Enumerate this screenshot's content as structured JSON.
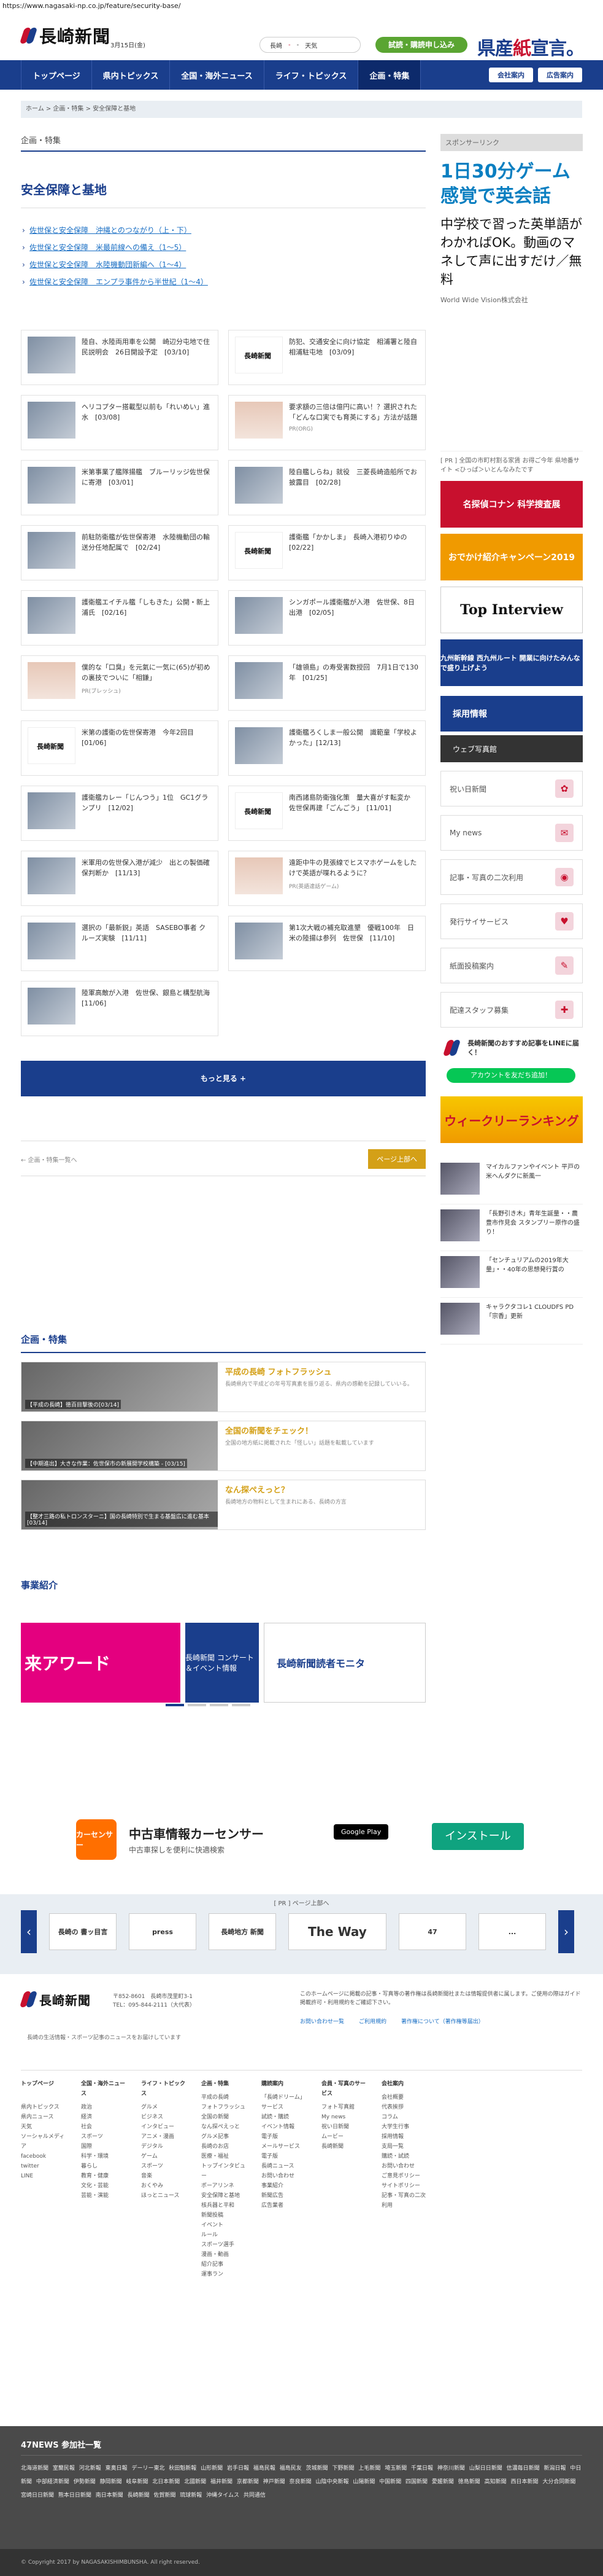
{
  "browser": {
    "url": "https://www.nagasaki-np.co.jp/feature/security-base/"
  },
  "header": {
    "logo": "長崎新聞",
    "date": "3月15日(金)",
    "weather": {
      "place": "長崎",
      "high": "-",
      "low": "-",
      "label": "天気"
    },
    "subscribe": "試読・購読申し込み",
    "campaign": {
      "a": "県産",
      "b": "紙",
      "c": "宣言"
    }
  },
  "nav": {
    "items": [
      "トップページ",
      "県内トピックス",
      "全国・海外ニュース",
      "ライフ・トピックス",
      "企画・特集"
    ],
    "member": "会社案内",
    "ad": "広告案内"
  },
  "breadcrumb": "ホーム > 企画・特集 > 安全保障と基地",
  "section_label": "企画・特集",
  "page_title": "安全保障と基地",
  "series": [
    "佐世保と安全保障　沖縄とのつながり（上・下）",
    "佐世保と安全保障　米最前線への備え（1～5）",
    "佐世保と安全保障　水陸機動団新編へ（1～4）",
    "佐世保と安全保障　エンプラ事件から半世紀（1～4）"
  ],
  "articles": [
    {
      "title": "陸自、水陸両用車を公開　崎辺分屯地で住民説明会　26日開設予定　[03/10]",
      "thumb": "photo",
      "src": ""
    },
    {
      "title": "防犯、交通安全に向け協定　相浦署と陸自相浦駐屯地　[03/09]",
      "thumb": "logo",
      "src": ""
    },
    {
      "title": "ヘリコプター搭載型以前も「れいめい」進水　[03/08]",
      "thumb": "photo",
      "src": ""
    },
    {
      "title": "要求額の三倍は億円に高い！？選択された「どんな口実でも育英にする」方法が話題",
      "thumb": "person",
      "src": "PR(ORG)"
    },
    {
      "title": "米第事業了艦隊揚艦　ブルーリッジ佐世保に寄港　[03/01]",
      "thumb": "photo",
      "src": ""
    },
    {
      "title": "陸自艦しらね」就役　三菱長崎造船所でお披露目　[02/28]",
      "thumb": "photo",
      "src": ""
    },
    {
      "title": "前駐防衛艦が佐世保寄港　水陸機動団の輸送分任地配属で　[02/24]",
      "thumb": "photo",
      "src": ""
    },
    {
      "title": "護衛艦「かかしま」　長崎入港初りゆの　[02/22]",
      "thumb": "logo",
      "src": ""
    },
    {
      "title": "護衛艦エイチル艦「しもきた」公開・新上浦氏　[02/16]",
      "thumb": "photo",
      "src": ""
    },
    {
      "title": "シンガポール護衛艦が入港　佐世保、8日出港　[02/05]",
      "thumb": "photo",
      "src": ""
    },
    {
      "title": "僕的な「口臭」を元氣に一気に(65)が初めの裏技でついに「相鎌」",
      "thumb": "person",
      "src": "PR(ブレッシュ)"
    },
    {
      "title": "「雄領島」の寿受害数授回　7月1日で130年　[01/25]",
      "thumb": "photo",
      "src": ""
    },
    {
      "title": "米第の護衛の佐世保寄港　今年2回目　[01/06]",
      "thumb": "logo",
      "src": ""
    },
    {
      "title": "護衛艦ろくしま一般公開　識範童「学校よかった」[12/13]",
      "thumb": "photo",
      "src": ""
    },
    {
      "title": "護衛艦カレー「じんつう」1位　GC1グランプリ　[12/02]",
      "thumb": "photo",
      "src": ""
    },
    {
      "title": "南西諸島防衛強化策　量大喜がす転変か　佐世保再建「ごんごう」　[11/01]",
      "thumb": "logo",
      "src": ""
    },
    {
      "title": "米軍用の佐世保入港が減少　出との製価確保判断か　[11/13]",
      "thumb": "photo",
      "src": ""
    },
    {
      "title": "遠距中牛の見張線でヒスマホゲームをしたけで英語が喋れるように？",
      "thumb": "person",
      "src": "PR(英語達話ゲーム)"
    },
    {
      "title": "選択の「最新鋭」英語　SASEBO事者 クルーズ実験　[11/11]",
      "thumb": "photo",
      "src": ""
    },
    {
      "title": "第1次大戦の補充取進墾　優戦100年　日米の陸揚は参列　佐世保　[11/10]",
      "thumb": "photo",
      "src": ""
    },
    {
      "title": "陸軍高敵が入港　佐世保、銀島と構型航海　[11/06]",
      "thumb": "photo",
      "src": ""
    }
  ],
  "more_button": "もっと見る +",
  "pager": {
    "back": "← 企画・特集一覧へ",
    "top": "ページ上部へ"
  },
  "sidebar": {
    "sponsor": "スポンサーリンク",
    "ad": {
      "headline": "1日30分ゲーム感覚で英会話",
      "body": "中学校で習った英単語がわかればOK。動画のマネして声に出すだけ／無料",
      "src": "World Wide Vision株式会社"
    },
    "ad_note": "[ PR ] 全国の市町村割る家賃 お得ご今年 県地番サイト <ひっぱ＞いとんなみたです",
    "banners": [
      "名探偵コナン 科学捜査展",
      "おでかけ紹介キャンペーン2019",
      "Top Interview",
      "九州新幹線 西九州ルート 開業に向けたみんなで盛り上げよう"
    ],
    "recruit": "採用情報",
    "recruit2": "ウェブ写真館",
    "services": [
      "祝い日新聞",
      "My news",
      "記事・写真の二次利用",
      "発行サイサービス",
      "紙面投稿案内",
      "配達スタッフ募集"
    ],
    "line": {
      "title": "長崎新聞のおすすめ記事をLINEに届く！",
      "button": "アカウントを友だち追加！"
    },
    "rank": "ウィークリーランキング",
    "side_news": [
      "マイカルファンやイベント 平戸の米へんダクに新風一",
      "「長野引き木」青年生誕量・・農豊市作見会 スタンプリー原作の盛り！",
      "「センチュリアムの2019年大量」・・40年の思想発行賞の",
      "キャラクタコレ1 CLOUDFS  PD「宗香」更新"
    ]
  },
  "features": {
    "title": "企画・特集",
    "items": [
      {
        "caption": "【平成の長崎】徳百目撃後の[03/14]",
        "title": "平成の長崎 フォトフラッシュ",
        "desc": "長崎県内で平成どの年号写真素を振り返る、県内の感動を記録していいる。"
      },
      {
        "caption": "【中期進出】大きな作業：佐世保市の新展開学校構築 - [03/15]",
        "title": "全国の新聞をチェック！",
        "desc": "全国の地方紙に掲載された「怪しい」話題を転載しています"
      },
      {
        "caption": "【整才三路の私トロンスターニ】国の長崎特別で生まる基盤広に進む基本 [03/14]",
        "title": "なん探ぺえっと？",
        "desc": "長崎地方の物料として生まれにある、長崎の方言"
      }
    ]
  },
  "business": {
    "title": "事業紹介",
    "slides": [
      "来アワード",
      "長崎新聞 コンサート＆イベント情報",
      "長崎新聞読者モニタ"
    ]
  },
  "bottom_ad": {
    "logo": "カーセンサー",
    "name": "中古車情報カーセンサー",
    "sub": "中古車探しを便利に快適検索",
    "store": "Google Play",
    "install": "インストール"
  },
  "partner_banners": {
    "label": "[ PR ] ページ上部へ",
    "items": [
      "長崎の 書ッ目言",
      "press",
      "長崎地方 新聞",
      "The Way",
      "47",
      "..."
    ]
  },
  "footer": {
    "logo": "長崎新聞",
    "address": "〒852-8601　長崎市茂里町3-1\nTEL：095-844-2111（大代表）",
    "note": "長崎の生活情報・スポーツ記事のニュースをお届けしています",
    "copyright": "このホームページに掲載の記事・写真等の著作権は長崎新聞社または情報提供者に属します。ご使用の際はガイド掲載許可・利用規約をご確認下さい。",
    "links": [
      "お問い合わせ一覧",
      "ご利用規約",
      "著作権について（著作権等届出）"
    ]
  },
  "sitemap": [
    {
      "head": "トップページ",
      "items": [
        "",
        "県内トピックス",
        "県内ニュース",
        "天気",
        "ソーシャルメディア",
        "facebook",
        "twitter",
        "LINE"
      ]
    },
    {
      "head": "全国・海外ニュース",
      "items": [
        "政治",
        "経済",
        "社会",
        "スポーツ",
        "国際",
        "科学・環境",
        "暮らし",
        "教育・健康",
        "文化・芸能",
        "芸能・演能"
      ]
    },
    {
      "head": "ライフ・トピックス",
      "items": [
        "グルメ",
        "ビジネス",
        "インタビュー",
        "アニメ・漫画",
        "デジタル",
        "ゲーム",
        "スポーツ",
        "音楽",
        "おくやみ",
        "ほっとニュース"
      ]
    },
    {
      "head": "企画・特集",
      "items": [
        "平成の長崎",
        "フォトフラッシュ",
        "全国の新聞",
        "なん探ぺえっと",
        "グルメ記事",
        "長崎のお店",
        "医療・福祉",
        "トップインタビュー",
        "ポーアリンネ",
        "安全保障と基地",
        "核兵器と平和",
        "新聞投稿",
        "イベント",
        "ルール",
        "スポーツ選手",
        "漫画・動画",
        "紹介記事",
        "運事ラン"
      ]
    },
    {
      "head": "購読案内",
      "items": [
        "「長崎ドリーム」サービス",
        "試読・購読",
        "イベント情報",
        "電子版",
        "メールサービス",
        "電子版",
        "長崎ニュース",
        "お問い合わせ",
        "事業紹介",
        "新聞広告",
        "広告業者"
      ]
    },
    {
      "head": "会員・写真のサービス",
      "items": [
        "フォト写真館",
        "My news",
        "祝い日新聞",
        "ムービー",
        "長崎新聞"
      ]
    },
    {
      "head": "会社案内",
      "items": [
        "会社概要",
        "代表挨拶",
        "コラム",
        "大学生行事",
        "採用情報",
        "支局一覧",
        "購読・試読",
        "お問い合わせ",
        "ご意見ポリシー",
        "サイトポリシー",
        "記事・写真の二次利用"
      ]
    }
  ],
  "network": {
    "title": "47NEWS 参加社一覧",
    "list": "北海道新聞 室蘭民報 河北新報 東奥日報 デーリー東北 秋田魁新報 山形新聞 岩手日報 福島民報 福島民友 茨城新聞 下野新聞 上毛新聞 埼玉新聞 千葉日報 神奈川新聞 山梨日日新聞 信濃毎日新聞 新潟日報 中日新聞 中部経済新聞 伊勢新聞 静岡新聞 岐阜新聞 北日本新聞 北國新聞 福井新聞 京都新聞 神戸新聞 奈良新聞 山陰中央新報 山陽新聞 中国新聞 四国新聞 愛媛新聞 徳島新聞 高知新聞 西日本新聞 大分合同新聞 宮崎日日新聞 熊本日日新聞 南日本新聞 長崎新聞 佐賀新聞 琉球新報 沖縄タイムス 共同通信"
  },
  "copyright": "© Copyright 2017 by NAGASAKISHIMBUNSHA. All right reserved."
}
